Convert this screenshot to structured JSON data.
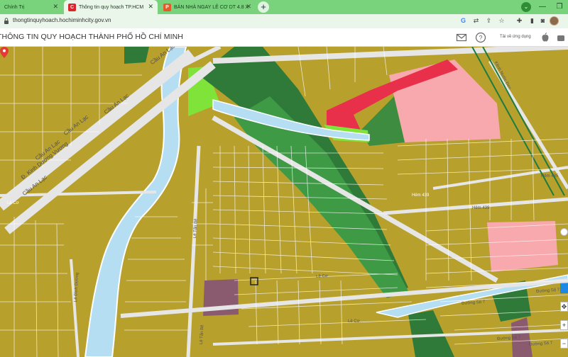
{
  "browser": {
    "tabs": [
      {
        "title": "Chính Trị",
        "favicon": "",
        "active": false
      },
      {
        "title": "Thông tin quy hoạch TP.HCM",
        "favicon": "C",
        "active": true
      },
      {
        "title": "BÁN NHÀ NGAY LÊ CƠ DT 4.8 X",
        "favicon": "P",
        "active": false
      }
    ],
    "new_tab_label": "+",
    "url": "thongtinquyhoach.hochiminhcity.gov.vn",
    "toolbar_icons": [
      "google-icon",
      "translate-icon",
      "share-icon",
      "star-icon",
      "extension-icon",
      "sidebar-icon",
      "avatar"
    ]
  },
  "site": {
    "title": "THÔNG TIN QUY HOẠCH THÀNH PHỐ HỒ CHÍ MINH",
    "app_download_label": "Tải về ứng dụng"
  },
  "map": {
    "street_labels": [
      "Cầu An Lạc",
      "Cầu An Lạc",
      "Cầu An Lạc",
      "Cầu An Lạc",
      "Đ. Kinh Dương Vương",
      "Cầu An Lạc",
      "Lê Đình Dương",
      "Lê Tấn Bê",
      "Lê Tấn Bê",
      "Hẻm 439",
      "Hẻm 439",
      "Hẻm 435",
      "Đường Số 7",
      "Đường Số 7",
      "Đường Số 7",
      "Lê Cơ",
      "Đường Số 7",
      "Lê Cơ",
      "Lê Cơ",
      "Kênh Nước Đen"
    ],
    "colors": {
      "residential": "#b8a02d",
      "river": "#b5def2",
      "green_park": "#3d8c3f",
      "dark_green": "#2e6f34",
      "lime": "#7fe33a",
      "commercial_red": "#e8304a",
      "pink": "#f7a9ad",
      "mauve": "#8a5a6e",
      "road": "#e6e6e6"
    },
    "zoom_in": "+",
    "zoom_out": "−"
  }
}
